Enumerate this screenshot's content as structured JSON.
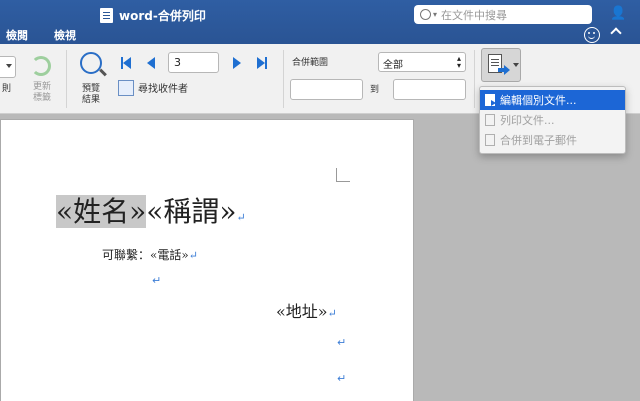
{
  "window": {
    "title": "word-合併列印"
  },
  "search": {
    "placeholder": "在文件中搜尋"
  },
  "tabs": [
    "檢閱",
    "檢視"
  ],
  "ribbon": {
    "rule_label": "則",
    "update_labels_line1": "更新",
    "update_labels_line2": "標籤",
    "preview_line1": "預覽",
    "preview_line2": "結果",
    "record_number": "3",
    "find_recipient": "尋找收件者",
    "merge_range_label": "合併範圍",
    "range_select": "全部",
    "range_from": "",
    "range_to_label": "到",
    "range_to": ""
  },
  "menu": {
    "items": [
      {
        "label": "編輯個別文件...",
        "state": "selected"
      },
      {
        "label": "列印文件...",
        "state": "disabled"
      },
      {
        "label": "合併到電子郵件",
        "state": "disabled"
      }
    ]
  },
  "document": {
    "line1_highlight": "«姓名»",
    "line1_rest": "«稱謂»",
    "line2": "可聯繫：«電話»",
    "line4": "«地址»",
    "paragraph_mark": "↵"
  },
  "colors": {
    "titlebar": "#2b5797",
    "accent": "#1c66d6",
    "ribbon_bg": "#f1f1f1",
    "workspace_bg": "#b9b9b9",
    "highlight": "#c8c8c8"
  }
}
